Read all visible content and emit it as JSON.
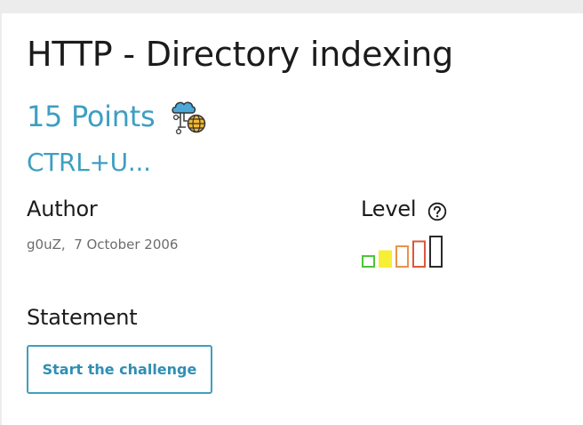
{
  "challenge": {
    "title": "HTTP - Directory indexing",
    "points": "15 Points",
    "subtitle": "CTRL+U...",
    "category_icon": "cloud-network-globe-icon"
  },
  "author": {
    "label": "Author",
    "name": "g0uZ",
    "separator": ",",
    "date": "7 October 2006"
  },
  "level": {
    "label": "Level",
    "help_icon": "question-circle-icon",
    "current": 2,
    "max": 5,
    "bars": [
      {
        "color": "#4cc43a",
        "filled": false
      },
      {
        "color": "#f7ee36",
        "filled": true
      },
      {
        "color": "#e8934b",
        "filled": false
      },
      {
        "color": "#d9583d",
        "filled": false
      },
      {
        "color": "#2a2a2a",
        "filled": false
      }
    ]
  },
  "statement": {
    "label": "Statement",
    "button_label": "Start the challenge"
  },
  "colors": {
    "accent": "#3e9fc1",
    "text": "#1b1b1b",
    "muted": "#6d6d6d",
    "page_background": "#ececec",
    "card_background": "#ffffff"
  }
}
